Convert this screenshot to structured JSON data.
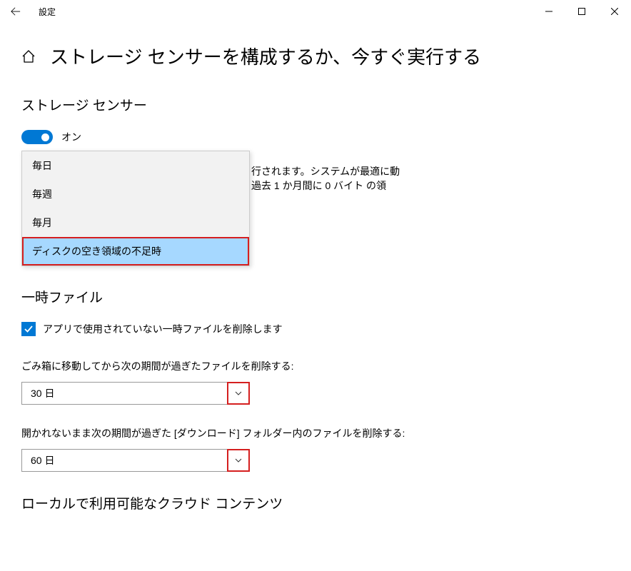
{
  "window": {
    "app_title": "設定"
  },
  "page": {
    "title": "ストレージ センサーを構成するか、今すぐ実行する"
  },
  "storage_sensor": {
    "heading": "ストレージ センサー",
    "toggle_label": "オン",
    "desc_line1": "行されます。システムが最適に動",
    "desc_line2": "過去 1 か月間に 0 バイト の領"
  },
  "frequency_dropdown": {
    "options": [
      "毎日",
      "毎週",
      "毎月",
      "ディスクの空き領域の不足時"
    ],
    "selected_index": 3
  },
  "temp_files": {
    "heading": "一時ファイル",
    "checkbox_label": "アプリで使用されていない一時ファイルを削除します",
    "recycle_label": "ごみ箱に移動してから次の期間が過ぎたファイルを削除する:",
    "recycle_value": "30 日",
    "downloads_label": "開かれないまま次の期間が過ぎた [ダウンロード] フォルダー内のファイルを削除する:",
    "downloads_value": "60 日"
  },
  "cloud": {
    "heading": "ローカルで利用可能なクラウド コンテンツ"
  }
}
